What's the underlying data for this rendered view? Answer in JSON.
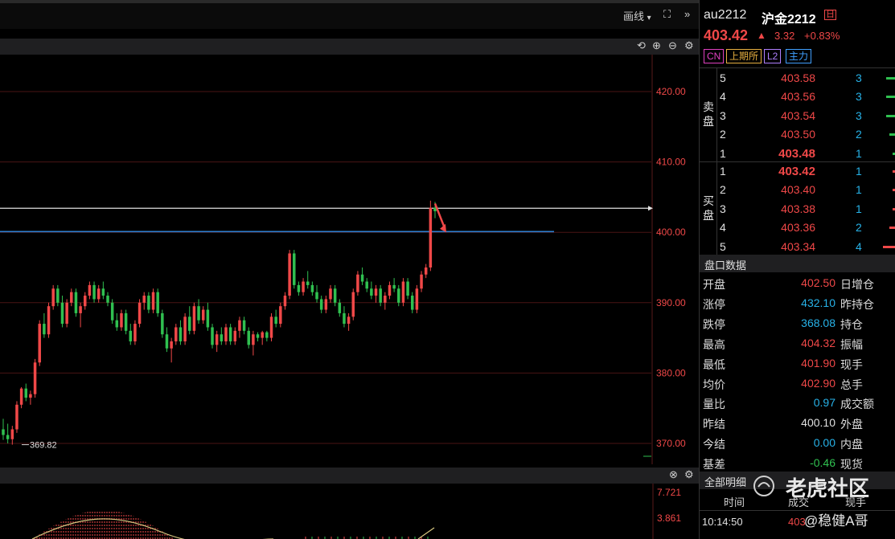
{
  "toolbar": {
    "draw_label": "画线",
    "draw_caret": "▾",
    "expand_icon": "⛶",
    "more_icon": "»"
  },
  "chart_controls": [
    "⟲",
    "⊕",
    "⊖",
    "⚙"
  ],
  "indicator_controls": [
    "⊗",
    "⚙"
  ],
  "chart_data": {
    "type": "candlestick",
    "y_axis_ticks": [
      "420.00",
      "410.00",
      "400.00",
      "390.00",
      "380.00",
      "370.00"
    ],
    "ylim": [
      368,
      423
    ],
    "low_annotation": "369.82",
    "reference_lines": [
      {
        "value": 403.42,
        "color": "#e0e0e0"
      },
      {
        "value": 400.1,
        "color": "#2f7fd0"
      }
    ],
    "candles": [
      [
        372.0,
        373.5,
        370.5,
        371.2
      ],
      [
        371.2,
        372.8,
        370.0,
        370.6
      ],
      [
        370.6,
        372.5,
        369.82,
        372.0
      ],
      [
        372.0,
        376.0,
        371.5,
        375.5
      ],
      [
        375.5,
        378.0,
        375.0,
        377.8
      ],
      [
        377.8,
        378.5,
        376.0,
        376.5
      ],
      [
        376.5,
        377.5,
        375.5,
        377.0
      ],
      [
        377.0,
        382.0,
        376.5,
        381.5
      ],
      [
        381.5,
        387.5,
        381.0,
        387.0
      ],
      [
        387.0,
        388.5,
        385.0,
        385.5
      ],
      [
        385.5,
        390.0,
        385.0,
        389.5
      ],
      [
        389.5,
        392.5,
        389.0,
        392.0
      ],
      [
        392.0,
        392.5,
        389.5,
        390.0
      ],
      [
        390.0,
        391.0,
        386.5,
        387.0
      ],
      [
        387.0,
        390.5,
        386.5,
        390.0
      ],
      [
        390.0,
        392.0,
        389.5,
        391.5
      ],
      [
        391.5,
        392.0,
        388.0,
        388.5
      ],
      [
        388.5,
        390.0,
        386.5,
        389.5
      ],
      [
        389.5,
        391.5,
        389.0,
        391.0
      ],
      [
        391.0,
        393.0,
        390.5,
        392.5
      ],
      [
        392.5,
        393.0,
        390.0,
        390.5
      ],
      [
        390.5,
        392.5,
        390.0,
        392.0
      ],
      [
        392.0,
        393.0,
        390.5,
        391.0
      ],
      [
        391.0,
        391.5,
        389.5,
        390.0
      ],
      [
        390.0,
        390.5,
        387.0,
        387.5
      ],
      [
        387.5,
        388.5,
        386.0,
        386.5
      ],
      [
        386.5,
        389.0,
        386.0,
        388.5
      ],
      [
        388.5,
        389.0,
        385.5,
        386.0
      ],
      [
        386.0,
        387.0,
        384.0,
        384.5
      ],
      [
        384.5,
        387.5,
        384.0,
        387.0
      ],
      [
        387.0,
        390.5,
        386.5,
        390.0
      ],
      [
        390.0,
        391.5,
        389.0,
        391.0
      ],
      [
        391.0,
        391.5,
        388.5,
        389.0
      ],
      [
        389.0,
        392.0,
        388.5,
        391.5
      ],
      [
        391.5,
        392.0,
        388.0,
        388.5
      ],
      [
        388.5,
        389.0,
        385.0,
        385.5
      ],
      [
        385.5,
        386.5,
        383.0,
        383.5
      ],
      [
        383.5,
        385.0,
        381.5,
        384.5
      ],
      [
        384.5,
        387.0,
        384.0,
        386.5
      ],
      [
        386.5,
        387.5,
        384.0,
        384.5
      ],
      [
        384.5,
        388.5,
        384.0,
        388.0
      ],
      [
        388.0,
        389.5,
        385.5,
        386.0
      ],
      [
        386.0,
        390.0,
        385.5,
        389.5
      ],
      [
        389.5,
        390.5,
        387.0,
        387.5
      ],
      [
        387.5,
        389.5,
        387.0,
        389.0
      ],
      [
        389.0,
        390.0,
        386.0,
        386.5
      ],
      [
        386.5,
        387.0,
        383.5,
        384.0
      ],
      [
        384.0,
        386.0,
        383.0,
        385.5
      ],
      [
        385.5,
        386.5,
        384.0,
        384.5
      ],
      [
        384.5,
        387.0,
        384.0,
        386.5
      ],
      [
        386.5,
        387.0,
        384.0,
        384.5
      ],
      [
        384.5,
        386.5,
        384.0,
        386.0
      ],
      [
        386.0,
        388.0,
        385.0,
        387.5
      ],
      [
        387.5,
        388.0,
        385.5,
        386.0
      ],
      [
        386.0,
        386.5,
        383.5,
        384.0
      ],
      [
        384.0,
        386.0,
        382.5,
        385.5
      ],
      [
        385.5,
        385.8,
        384.5,
        385.0
      ],
      [
        385.0,
        386.0,
        384.0,
        385.8
      ],
      [
        385.8,
        386.0,
        384.5,
        385.0
      ],
      [
        385.0,
        388.5,
        384.5,
        388.0
      ],
      [
        388.0,
        389.0,
        386.5,
        387.0
      ],
      [
        387.0,
        390.0,
        386.5,
        389.5
      ],
      [
        389.5,
        391.5,
        389.0,
        391.0
      ],
      [
        391.0,
        397.5,
        390.5,
        397.0
      ],
      [
        397.0,
        397.5,
        392.0,
        392.5
      ],
      [
        392.5,
        393.0,
        391.0,
        391.5
      ],
      [
        391.5,
        393.5,
        391.0,
        393.0
      ],
      [
        393.0,
        394.5,
        392.0,
        392.5
      ],
      [
        392.5,
        393.0,
        391.0,
        391.5
      ],
      [
        391.5,
        392.5,
        390.0,
        390.5
      ],
      [
        390.5,
        391.0,
        388.5,
        389.0
      ],
      [
        389.0,
        391.0,
        388.5,
        390.5
      ],
      [
        390.5,
        392.5,
        390.0,
        392.0
      ],
      [
        392.0,
        392.5,
        389.5,
        390.0
      ],
      [
        390.0,
        390.5,
        388.0,
        388.5
      ],
      [
        388.5,
        389.5,
        386.5,
        387.0
      ],
      [
        387.0,
        388.5,
        386.0,
        388.0
      ],
      [
        388.0,
        392.0,
        387.5,
        391.5
      ],
      [
        391.5,
        394.5,
        391.0,
        394.0
      ],
      [
        394.0,
        395.0,
        392.5,
        393.0
      ],
      [
        393.0,
        393.5,
        391.5,
        392.0
      ],
      [
        392.0,
        393.0,
        390.5,
        391.0
      ],
      [
        391.0,
        392.5,
        390.0,
        392.0
      ],
      [
        392.0,
        392.5,
        389.5,
        390.0
      ],
      [
        390.0,
        391.5,
        389.0,
        391.0
      ],
      [
        391.0,
        393.0,
        390.5,
        392.5
      ],
      [
        392.5,
        393.5,
        391.5,
        392.0
      ],
      [
        392.0,
        392.5,
        389.5,
        390.0
      ],
      [
        390.0,
        393.5,
        389.5,
        393.0
      ],
      [
        393.0,
        393.5,
        390.5,
        391.0
      ],
      [
        391.0,
        391.5,
        388.5,
        389.0
      ],
      [
        389.0,
        392.5,
        388.5,
        392.0
      ],
      [
        392.0,
        394.5,
        391.5,
        394.0
      ],
      [
        394.0,
        395.5,
        393.5,
        395.0
      ],
      [
        395.0,
        404.5,
        394.5,
        403.5
      ],
      [
        403.5,
        404.32,
        402.0,
        403.0
      ]
    ]
  },
  "indicator": {
    "ticks": [
      "7.721",
      "3.861"
    ]
  },
  "quote": {
    "code": "au2212",
    "name": "沪金2212",
    "name_badge": "日",
    "price": "403.42",
    "arrow": "▲",
    "change": "3.32",
    "change_pct": "+0.83%",
    "tags": [
      {
        "label": "CN",
        "color": "#e040c0"
      },
      {
        "label": "上期所",
        "color": "#e8b040"
      },
      {
        "label": "L2",
        "color": "#b080ff"
      },
      {
        "label": "主力",
        "color": "#40a0ff"
      }
    ]
  },
  "orderbook": {
    "sell_label": "卖盘",
    "buy_label": "买盘",
    "asks": [
      {
        "level": "5",
        "price": "403.58",
        "vol": "3"
      },
      {
        "level": "4",
        "price": "403.56",
        "vol": "3"
      },
      {
        "level": "3",
        "price": "403.54",
        "vol": "3"
      },
      {
        "level": "2",
        "price": "403.50",
        "vol": "2"
      },
      {
        "level": "1",
        "price": "403.48",
        "vol": "1"
      }
    ],
    "bids": [
      {
        "level": "1",
        "price": "403.42",
        "vol": "1"
      },
      {
        "level": "2",
        "price": "403.40",
        "vol": "1"
      },
      {
        "level": "3",
        "price": "403.38",
        "vol": "1"
      },
      {
        "level": "4",
        "price": "403.36",
        "vol": "2"
      },
      {
        "level": "5",
        "price": "403.34",
        "vol": "4"
      }
    ]
  },
  "panel_data": {
    "title": "盘口数据",
    "rows": [
      {
        "label": "开盘",
        "value": "402.50",
        "color": "#f04848",
        "label2": "日增仓"
      },
      {
        "label": "涨停",
        "value": "432.10",
        "color": "#27b2e8",
        "label2": "昨持仓"
      },
      {
        "label": "跌停",
        "value": "368.08",
        "color": "#27b2e8",
        "label2": "持仓"
      },
      {
        "label": "最高",
        "value": "404.32",
        "color": "#f04848",
        "label2": "振幅"
      },
      {
        "label": "最低",
        "value": "401.90",
        "color": "#f04848",
        "label2": "现手"
      },
      {
        "label": "均价",
        "value": "402.90",
        "color": "#f04848",
        "label2": "总手"
      },
      {
        "label": "量比",
        "value": "0.97",
        "color": "#27b2e8",
        "label2": "成交额"
      },
      {
        "label": "昨结",
        "value": "400.10",
        "color": "#e0e0e0",
        "label2": "外盘"
      },
      {
        "label": "今结",
        "value": "0.00",
        "color": "#27b2e8",
        "label2": "内盘"
      },
      {
        "label": "基差",
        "value": "-0.46",
        "color": "#30c050",
        "label2": "现货"
      }
    ]
  },
  "detail": {
    "title": "全部明细",
    "col_time": "时间",
    "col_price": "成交",
    "col_qty": "现手",
    "first_time": "10:14:50",
    "first_price": "403"
  },
  "watermark": {
    "brand": "老虎社区",
    "user": "@稳健A哥"
  }
}
